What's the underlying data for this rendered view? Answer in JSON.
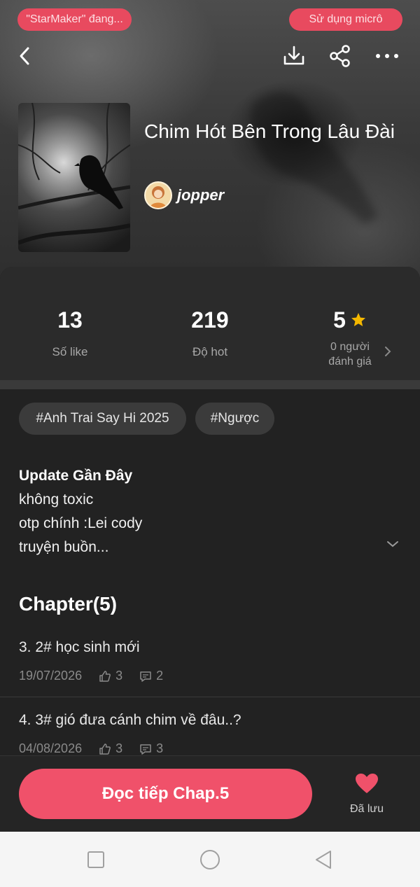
{
  "status_bar": {
    "left_pill": "\"StarMaker\" đang...",
    "right_pill": "Sử dụng micrô"
  },
  "story": {
    "title": "Chim Hót Bên Trong Lâu Đài",
    "author": "jopper"
  },
  "stats": {
    "likes_value": "13",
    "likes_label": "Số like",
    "hot_value": "219",
    "hot_label": "Độ hot",
    "rating_value": "5",
    "rating_label_line1": "0 người",
    "rating_label_line2": "đánh giá"
  },
  "tags": [
    "#Anh Trai Say Hi 2025",
    "#Ngược"
  ],
  "description": {
    "heading": "Update Gần Đây",
    "lines": [
      "không toxic",
      "otp chính :Lei cody",
      "truyện buồn..."
    ]
  },
  "chapters": {
    "header": "Chapter(5)",
    "items": [
      {
        "title": "3. 2# học sinh mới",
        "date": "19/07/2026",
        "likes": "3",
        "comments": "2"
      },
      {
        "title": "4. 3# gió đưa cánh chim về đâu..?",
        "date": "04/08/2026",
        "likes": "3",
        "comments": "3"
      }
    ]
  },
  "actions": {
    "read_button": "Đọc tiếp Chap.5",
    "saved_label": "Đã lưu"
  },
  "colors": {
    "accent": "#f0516a",
    "star": "#f5b800",
    "panel": "#222222"
  },
  "icons": [
    "back-icon",
    "download-icon",
    "share-icon",
    "more-icon",
    "star-icon",
    "chevron-right-icon",
    "chevron-down-icon",
    "thumbs-up-icon",
    "comment-icon",
    "heart-icon"
  ]
}
